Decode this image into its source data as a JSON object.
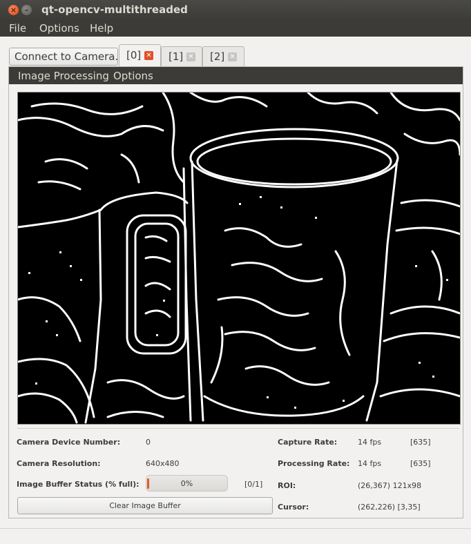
{
  "window": {
    "title": "qt-opencv-multithreaded"
  },
  "menubar": {
    "file": "File",
    "options": "Options",
    "help": "Help"
  },
  "tabs": {
    "connect_label": "Connect to Camera...",
    "items": [
      {
        "label": "[0]"
      },
      {
        "label": "[1]"
      },
      {
        "label": "[2]"
      }
    ]
  },
  "panel_menu": {
    "image_processing": "Image Processing",
    "options": "Options"
  },
  "stats": {
    "camera_device_number_label": "Camera Device Number:",
    "camera_device_number": "0",
    "camera_resolution_label": "Camera Resolution:",
    "camera_resolution": "640x480",
    "image_buffer_status_label": "Image Buffer Status (% full):",
    "buffer_percent_text": "0%",
    "buffer_fill_fraction": 0.02,
    "buffer_count": "[0/1]",
    "capture_rate_label": "Capture Rate:",
    "capture_rate": "14 fps",
    "capture_frames": "[635]",
    "processing_rate_label": "Processing Rate:",
    "processing_rate": "14 fps",
    "processing_frames": "[635]",
    "roi_label": "ROI:",
    "roi": "(26,367) 121x98",
    "cursor_label": "Cursor:",
    "cursor": "(262,226) [3,35]"
  },
  "buttons": {
    "clear_image_buffer": "Clear Image Buffer"
  },
  "colors": {
    "accent": "#df4a16",
    "titlebar": "#3c3b37",
    "frame_bg": "#000000",
    "edge": "#ffffff"
  }
}
